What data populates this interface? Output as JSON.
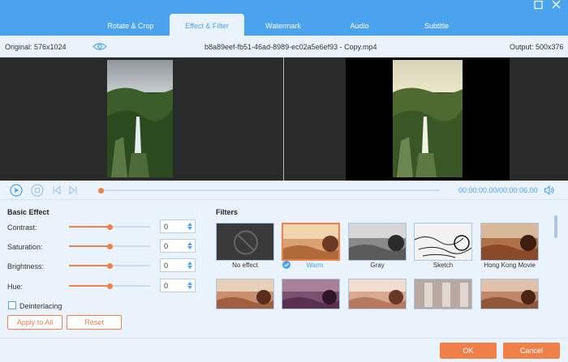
{
  "tabs": [
    {
      "label": "Rotate & Crop"
    },
    {
      "label": "Effect & Filter"
    },
    {
      "label": "Watermark"
    },
    {
      "label": "Audio"
    },
    {
      "label": "Subtitle"
    }
  ],
  "info": {
    "original": "Original: 576x1024",
    "filename": "b8a89eef-fb51-46ad-8989-ec02a5e6ef93 - Copy.mp4",
    "output": "Output: 500x376"
  },
  "playback": {
    "time": "00:00:00.00/00:00:06.00",
    "progress": 0.0
  },
  "basic_effect": {
    "title": "Basic Effect",
    "controls": [
      {
        "label": "Contrast:",
        "value": "0",
        "level": 0.5
      },
      {
        "label": "Saturation:",
        "value": "0",
        "level": 0.5
      },
      {
        "label": "Brightness:",
        "value": "0",
        "level": 0.5
      },
      {
        "label": "Hue:",
        "value": "0",
        "level": 0.5
      }
    ],
    "deinterlacing": "Deinterlacing",
    "apply_all": "Apply to All",
    "reset": "Reset"
  },
  "filters": {
    "title": "Filters",
    "items": [
      {
        "label": "No effect"
      },
      {
        "label": "Warm",
        "selected": true
      },
      {
        "label": "Gray"
      },
      {
        "label": "Sketch"
      },
      {
        "label": "Hong Kong Movie"
      }
    ]
  },
  "footer": {
    "ok": "OK",
    "cancel": "Cancel"
  },
  "colors": {
    "accent": "#4aa3ec",
    "orange": "#f0804a"
  }
}
